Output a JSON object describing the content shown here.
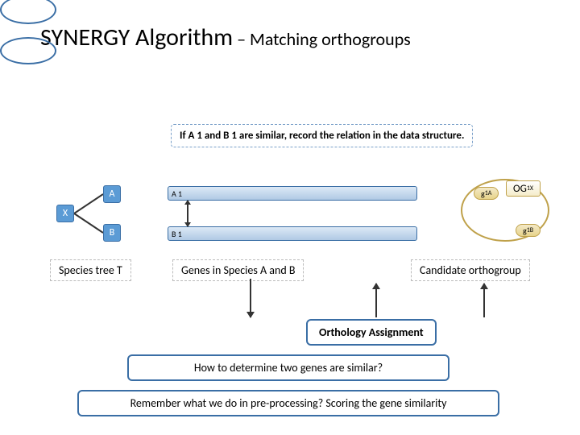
{
  "title": {
    "main": "SYNERGY Algorithm",
    "sep": " – ",
    "sub": "Matching orthogroups"
  },
  "info": "If A 1 and B 1 are similar, record the relation in the data structure.",
  "tree": {
    "x": "X",
    "a": "A",
    "b": "B"
  },
  "genes": {
    "a1": "A 1",
    "b1": "B 1"
  },
  "og": {
    "ga_pre": "g",
    "ga_sub": "1",
    "ga_sup": "A",
    "gb_pre": "g",
    "gb_sub": "1",
    "gb_sup": "B",
    "og_pre": "OG",
    "og_sub": "1",
    "og_sup": "X"
  },
  "captions": {
    "st": "Species tree T",
    "ge": "Genes in Species A and B",
    "co": "Candidate orthogroup"
  },
  "ortho": "Orthology Assignment",
  "question": "How to determine two genes are similar?",
  "reminder": "Remember what we do in pre-processing? Scoring the gene similarity"
}
